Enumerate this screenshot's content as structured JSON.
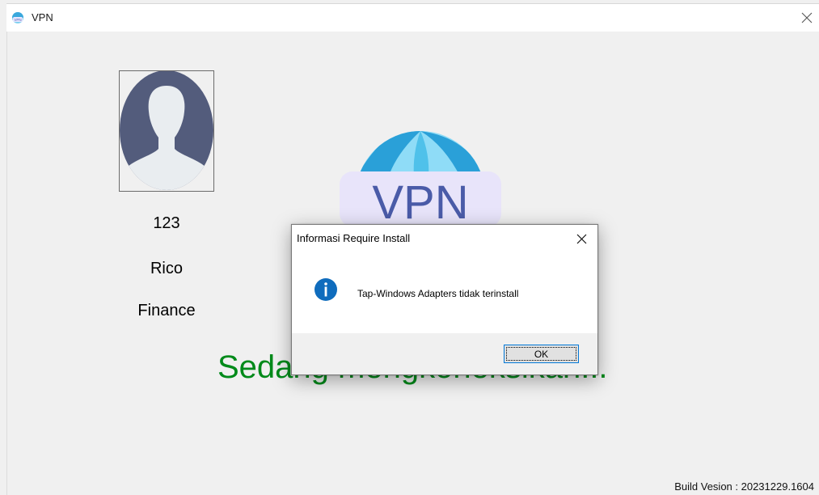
{
  "window": {
    "title": "VPN",
    "icon": "vpn-globe-icon",
    "close_icon": "close-icon"
  },
  "profile": {
    "avatar_icon": "user-silhouette-icon",
    "id": "123",
    "name": "Rico",
    "department": "Finance"
  },
  "logo": {
    "icon": "vpn-logo-icon",
    "text": "VPN"
  },
  "status": {
    "text": "Sedang mengkoneksikan..."
  },
  "build": {
    "text": "Build Vesion : 20231229.1604"
  },
  "dialog": {
    "title": "Informasi Require Install",
    "icon": "info-icon",
    "message": "Tap-Windows Adapters tidak terinstall",
    "ok_label": "OK"
  },
  "colors": {
    "status_green": "#008a1a",
    "info_blue": "#0f6cbd",
    "avatar_dark": "#505a78",
    "focus_blue": "#0078d7"
  }
}
